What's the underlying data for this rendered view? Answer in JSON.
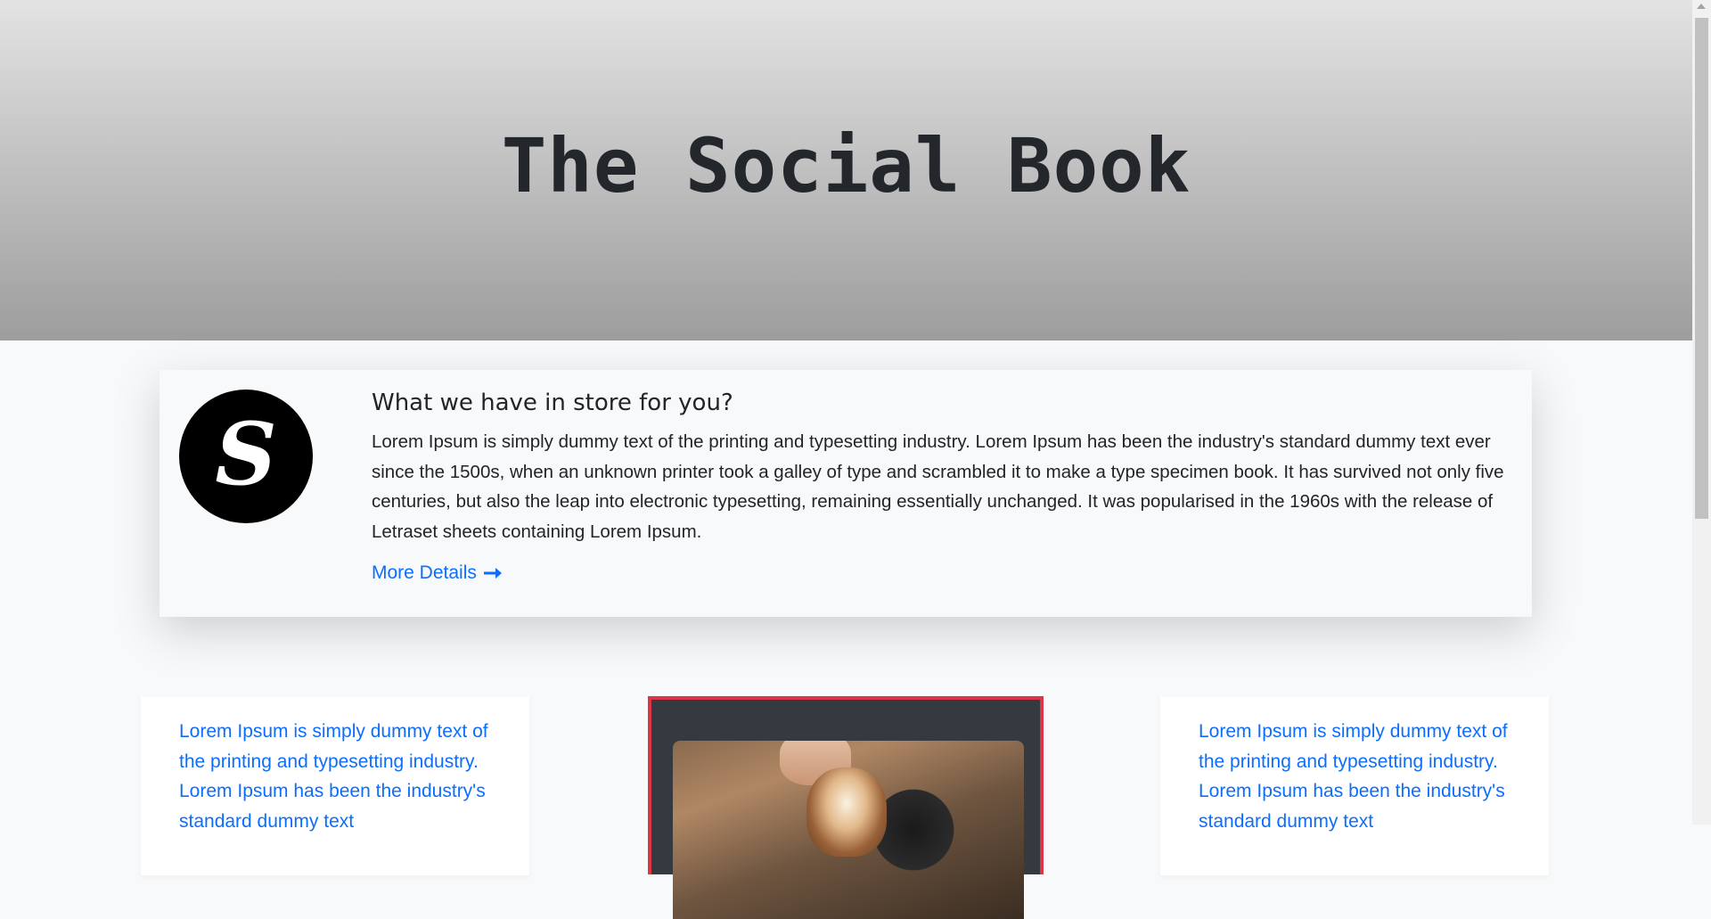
{
  "hero": {
    "title": "The Social Book"
  },
  "feature": {
    "logo_letter": "S",
    "heading": "What we have in store for you?",
    "body": "Lorem Ipsum is simply dummy text of the printing and typesetting industry. Lorem Ipsum has been the industry's standard dummy text ever since the 1500s, when an unknown printer took a galley of type and scrambled it to make a type specimen book. It has survived not only five centuries, but also the leap into electronic typesetting, remaining essentially unchanged. It was popularised in the 1960s with the release of Letraset sheets containing Lorem Ipsum.",
    "link_label": "More Details",
    "link_icon": "arrow-right-icon"
  },
  "cards": {
    "left_text": "Lorem Ipsum is simply dummy text of the printing and typesetting industry. Lorem Ipsum has been the industry's standard dummy text",
    "right_text": "Lorem Ipsum is simply dummy text of the printing and typesetting industry. Lorem Ipsum has been the industry's standard dummy text",
    "center_image": "latte-art-coffee-image"
  },
  "colors": {
    "link": "#0d6efd",
    "card_border": "#dc3545",
    "card_dark": "#343a40"
  }
}
